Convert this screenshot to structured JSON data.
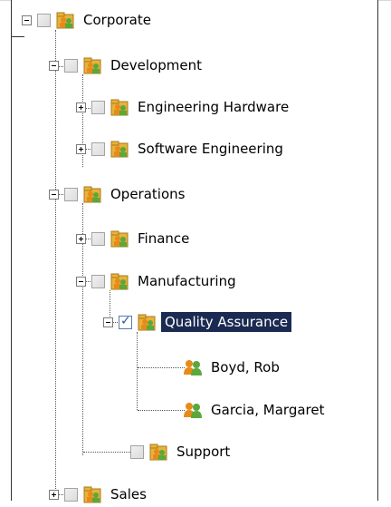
{
  "tree": {
    "corporate": {
      "label": "Corporate",
      "expanded": true
    },
    "development": {
      "label": "Development",
      "expanded": true
    },
    "engineering_hardware": {
      "label": "Engineering Hardware",
      "expanded": false
    },
    "software_engineering": {
      "label": "Software Engineering",
      "expanded": false
    },
    "operations": {
      "label": "Operations",
      "expanded": true
    },
    "finance": {
      "label": "Finance",
      "expanded": false
    },
    "manufacturing": {
      "label": "Manufacturing",
      "expanded": true
    },
    "quality_assurance": {
      "label": "Quality Assurance",
      "expanded": true,
      "checked": true,
      "selected": true
    },
    "boyd_rob": {
      "label": "Boyd, Rob"
    },
    "garcia_margaret": {
      "label": "Garcia, Margaret"
    },
    "support": {
      "label": "Support"
    },
    "sales": {
      "label": "Sales",
      "expanded": false
    }
  },
  "colors": {
    "selection": "#1a2a52",
    "folder": "#e8b23c",
    "person_orange": "#e88a1a",
    "person_green": "#5aa83a"
  },
  "icons": {
    "group": "group-folder-icon",
    "user": "user-group-icon"
  }
}
